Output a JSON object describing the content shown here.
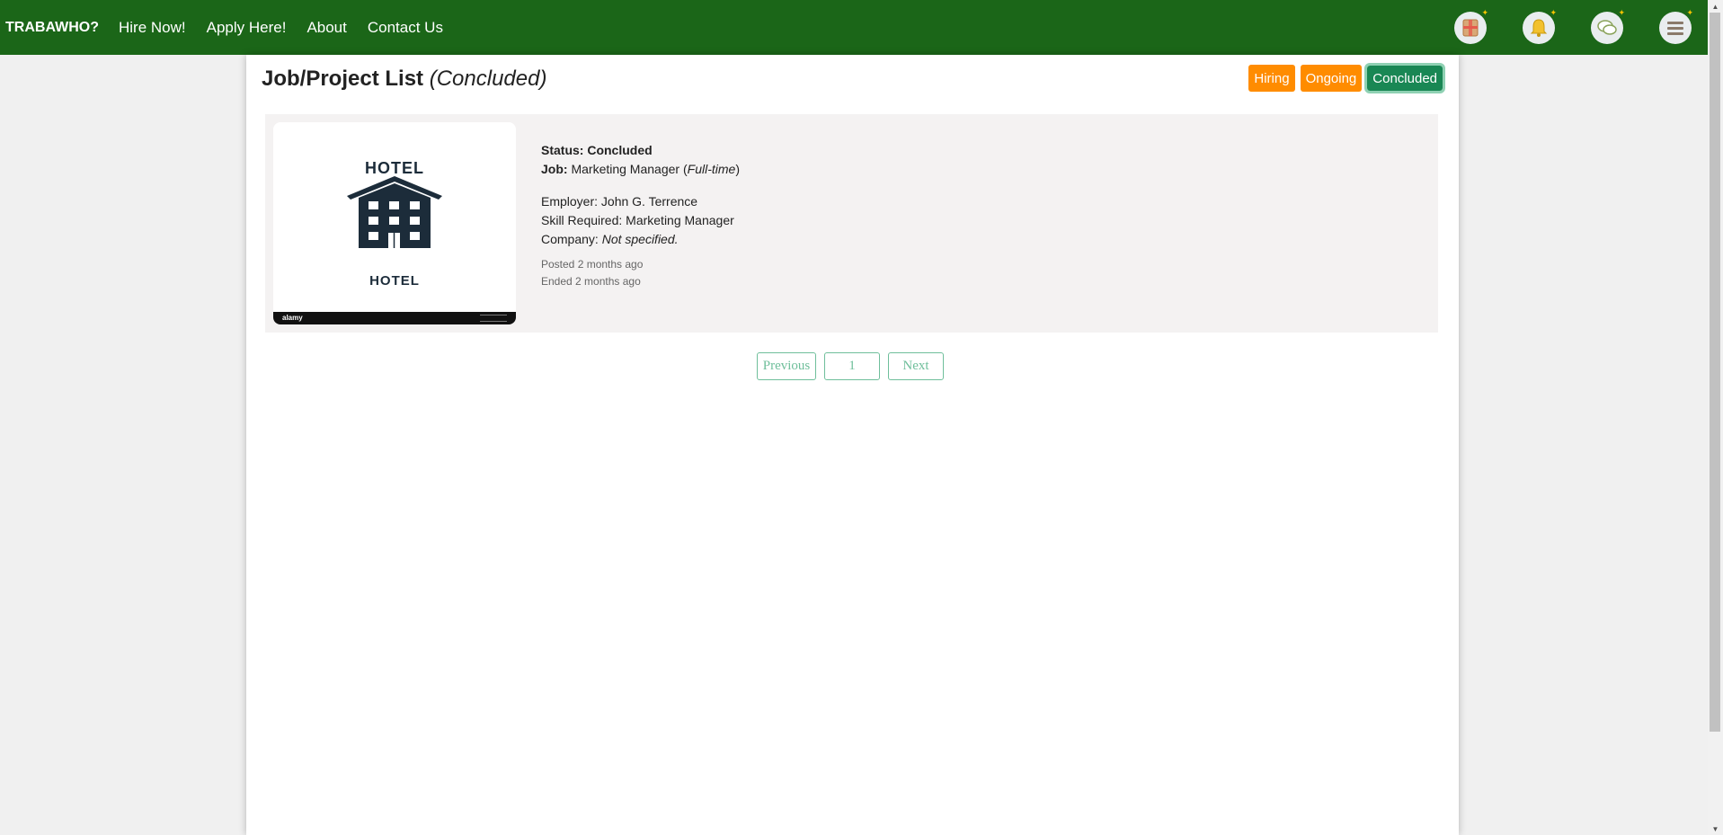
{
  "navbar": {
    "brand": "TRABAWHO?",
    "links": [
      "Hire Now!",
      "Apply Here!",
      "About",
      "Contact Us"
    ],
    "icons": [
      "briefcase-icon",
      "bell-icon",
      "chat-icon",
      "menu-icon"
    ],
    "background_color": "#1b6618"
  },
  "main": {
    "title": "Job/Project List",
    "title_sub": "(Concluded)",
    "filters": [
      {
        "label": "Hiring",
        "active": false
      },
      {
        "label": "Ongoing",
        "active": false
      },
      {
        "label": "Concluded",
        "active": true
      }
    ],
    "colors": {
      "filter": "#ff8c00",
      "filter_active": "#198754"
    }
  },
  "job": {
    "thumbnail_text": "HOTEL",
    "thumbnail_footer": "alamy",
    "status_label": "Status:",
    "status_value": "Concluded",
    "job_label": "Job:",
    "job_title": "Marketing Manager",
    "job_type": "Full-time",
    "employer_label": "Employer:",
    "employer": "John G. Terrence",
    "skill_label": "Skill Required:",
    "skill": "Marketing Manager",
    "company_label": "Company:",
    "company": "Not specified.",
    "posted": "Posted 2 months ago",
    "ended": "Ended 2 months ago"
  },
  "pagination": {
    "previous": "Previous",
    "page": "1",
    "next": "Next"
  }
}
